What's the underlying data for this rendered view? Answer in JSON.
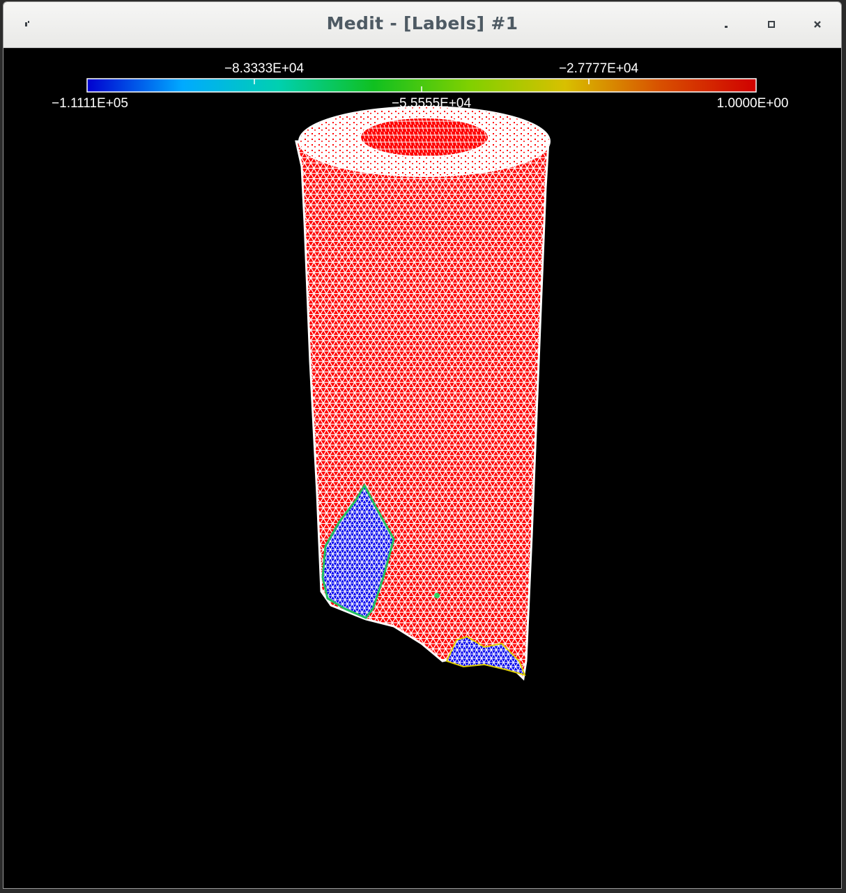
{
  "window": {
    "title": "Medit - [Labels] #1"
  },
  "titlebar_icons": {
    "menu": "window-menu-icon",
    "minimize": "minimize-icon",
    "maximize": "maximize-icon",
    "close": "close-icon"
  },
  "colorbar": {
    "min": -111110,
    "max": 1,
    "colormap": [
      "#0000d0",
      "#00aaff",
      "#00d0b0",
      "#10c020",
      "#80d000",
      "#d8c000",
      "#d85000",
      "#d00000"
    ],
    "labels_top": [
      "−8.3333E+04",
      "−2.7777E+04"
    ],
    "labels_bottom": [
      "−1.1111E+05",
      "−5.5555E+04",
      "1.0000E+00"
    ]
  },
  "colors": {
    "background": "#000000",
    "mesh_fill": "#ff0000",
    "mesh_lines": "#ffffff",
    "low_region": "#0000ee"
  }
}
